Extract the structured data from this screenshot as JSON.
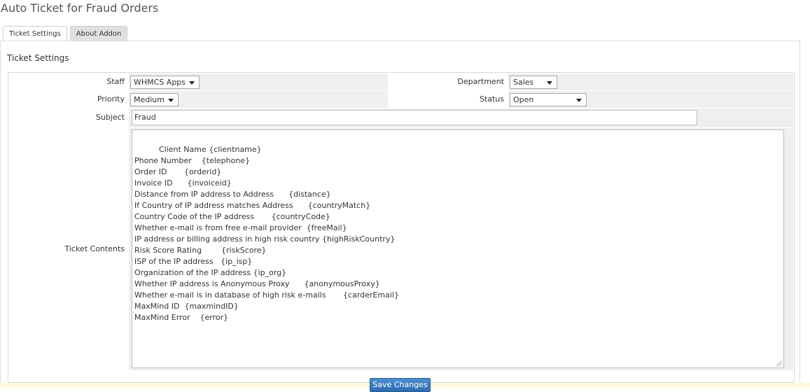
{
  "page": {
    "title": "Auto Ticket for Fraud Orders"
  },
  "tabs": [
    {
      "label": "Ticket Settings",
      "active": true
    },
    {
      "label": "About Addon",
      "active": false
    }
  ],
  "panel": {
    "heading": "Ticket Settings"
  },
  "form": {
    "staff": {
      "label": "Staff",
      "value": "WHMCS Apps"
    },
    "department": {
      "label": "Department",
      "value": "Sales"
    },
    "priority": {
      "label": "Priority",
      "value": "Medium"
    },
    "status": {
      "label": "Status",
      "value": "Open"
    },
    "subject": {
      "label": "Subject",
      "value": "Fraud"
    },
    "contents": {
      "label": "Ticket Contents",
      "value": "Client Name {clientname}\nPhone Number    {telephone}\nOrder ID       {orderid}\nInvoice ID      {invoiceid}\nDistance from IP address to Address      {distance}\nIf Country of IP address matches Address      {countryMatch}\nCountry Code of the IP address       {countryCode}\nWhether e-mail is from free e-mail provider  {freeMail}\nIP address or billing address in high risk country {highRiskCountry}\nRisk Score Rating        {riskScore}\nISP of the IP address   {ip_isp}\nOrganization of the IP address {ip_org}\nWhether IP address is Anonymous Proxy      {anonymousProxy}\nWhether e-mail is in database of high risk e-mails       {carderEmail}\nMaxMind ID  {maxmindID}\nMaxMind Error    {error}"
    }
  },
  "actions": {
    "save_label": "Save Changes"
  },
  "colors": {
    "label_bg": "#ffffff",
    "field_bg": "#efefef",
    "button": "#3a7cc0",
    "footer": "#fdf9dc"
  }
}
